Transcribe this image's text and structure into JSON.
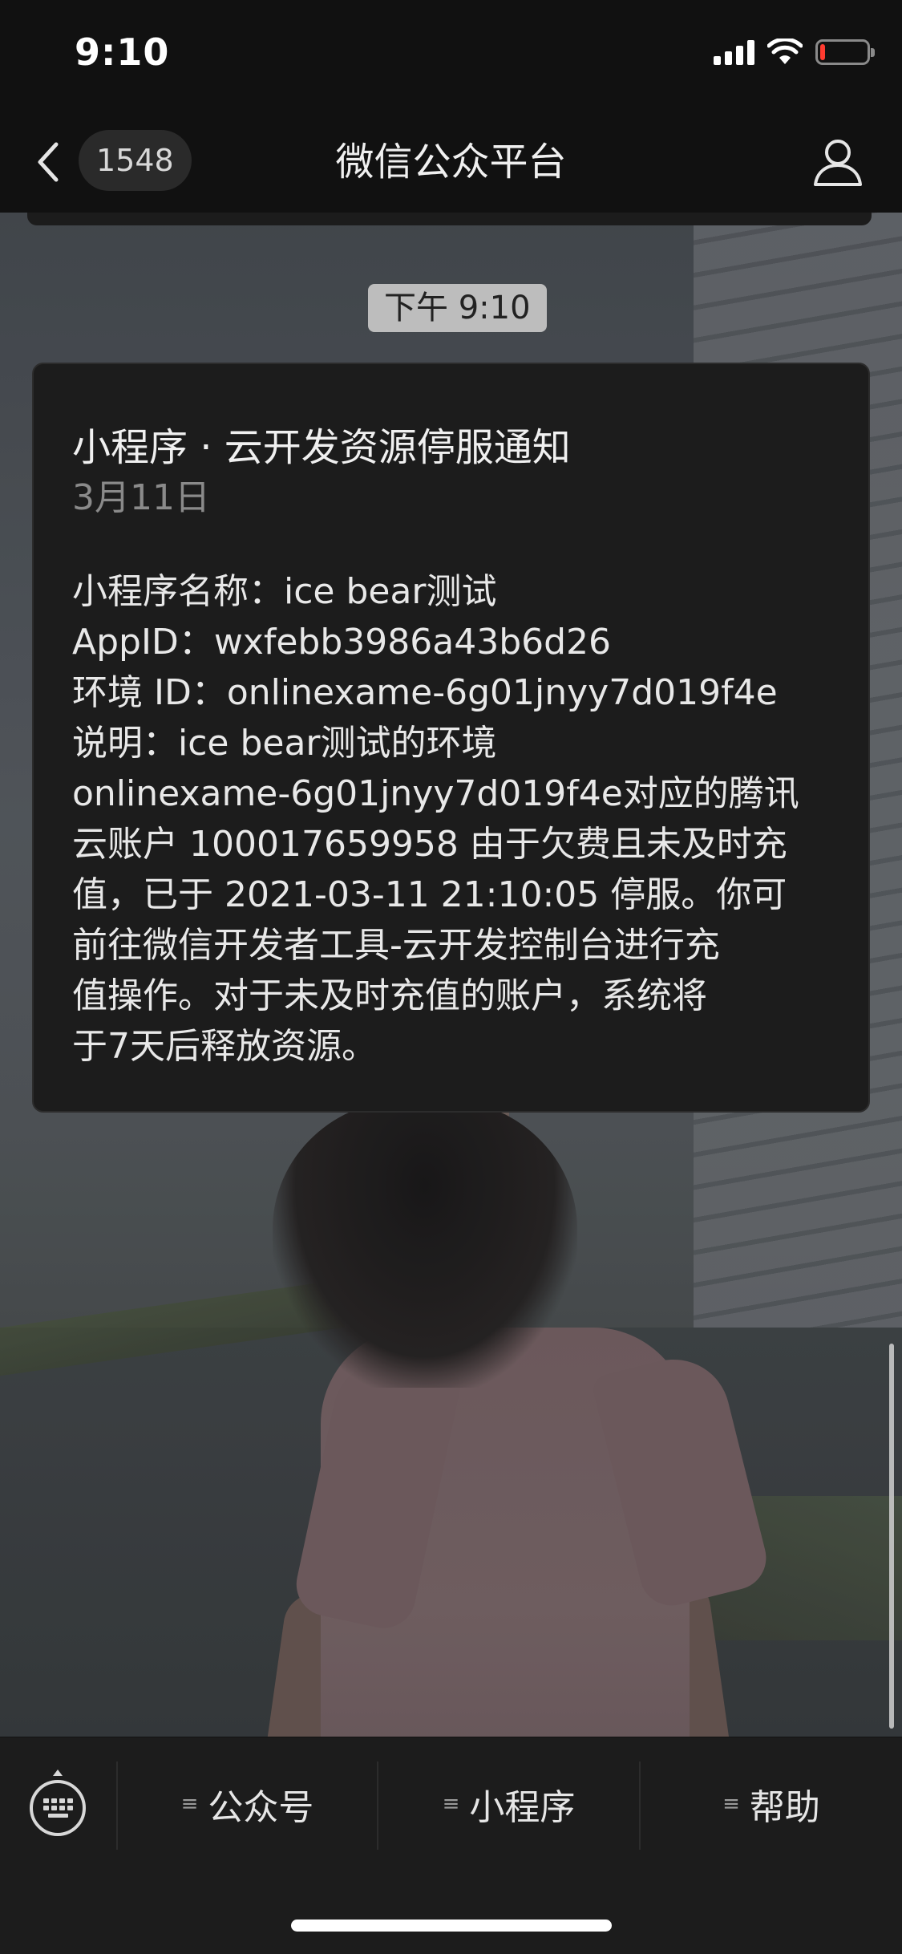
{
  "status_bar": {
    "time": "9:10",
    "battery_level_fraction": 0.1,
    "battery_color": "#ff3b30"
  },
  "nav": {
    "back_icon": "chevron-left-icon",
    "unread_count": "1548",
    "title": "微信公众平台",
    "profile_icon": "person-icon"
  },
  "chat": {
    "timestamp": "下午 9:10",
    "message": {
      "title": "小程序 · 云开发资源停服通知",
      "date": "3月11日",
      "body_lines": [
        "小程序名称：ice bear测试",
        "AppID：wxfebb3986a43b6d26",
        "环境 ID：onlinexame-6g01jnyy7d019f4e",
        "说明：ice bear测试的环境",
        "onlinexame-6g01jnyy7d019f4e对应的腾讯",
        "云账户 100017659958 由于欠费且未及时充",
        "值，已于 2021-03-11 21:10:05 停服。你可",
        "前往微信开发者工具-云开发控制台进行充",
        "值操作。对于未及时充值的账户，系统将",
        "于7天后释放资源。"
      ]
    }
  },
  "menu_bar": {
    "keyboard_icon": "keyboard-icon",
    "menu_glyph": "≡",
    "items": [
      {
        "label": "公众号"
      },
      {
        "label": "小程序"
      },
      {
        "label": "帮助"
      }
    ]
  }
}
